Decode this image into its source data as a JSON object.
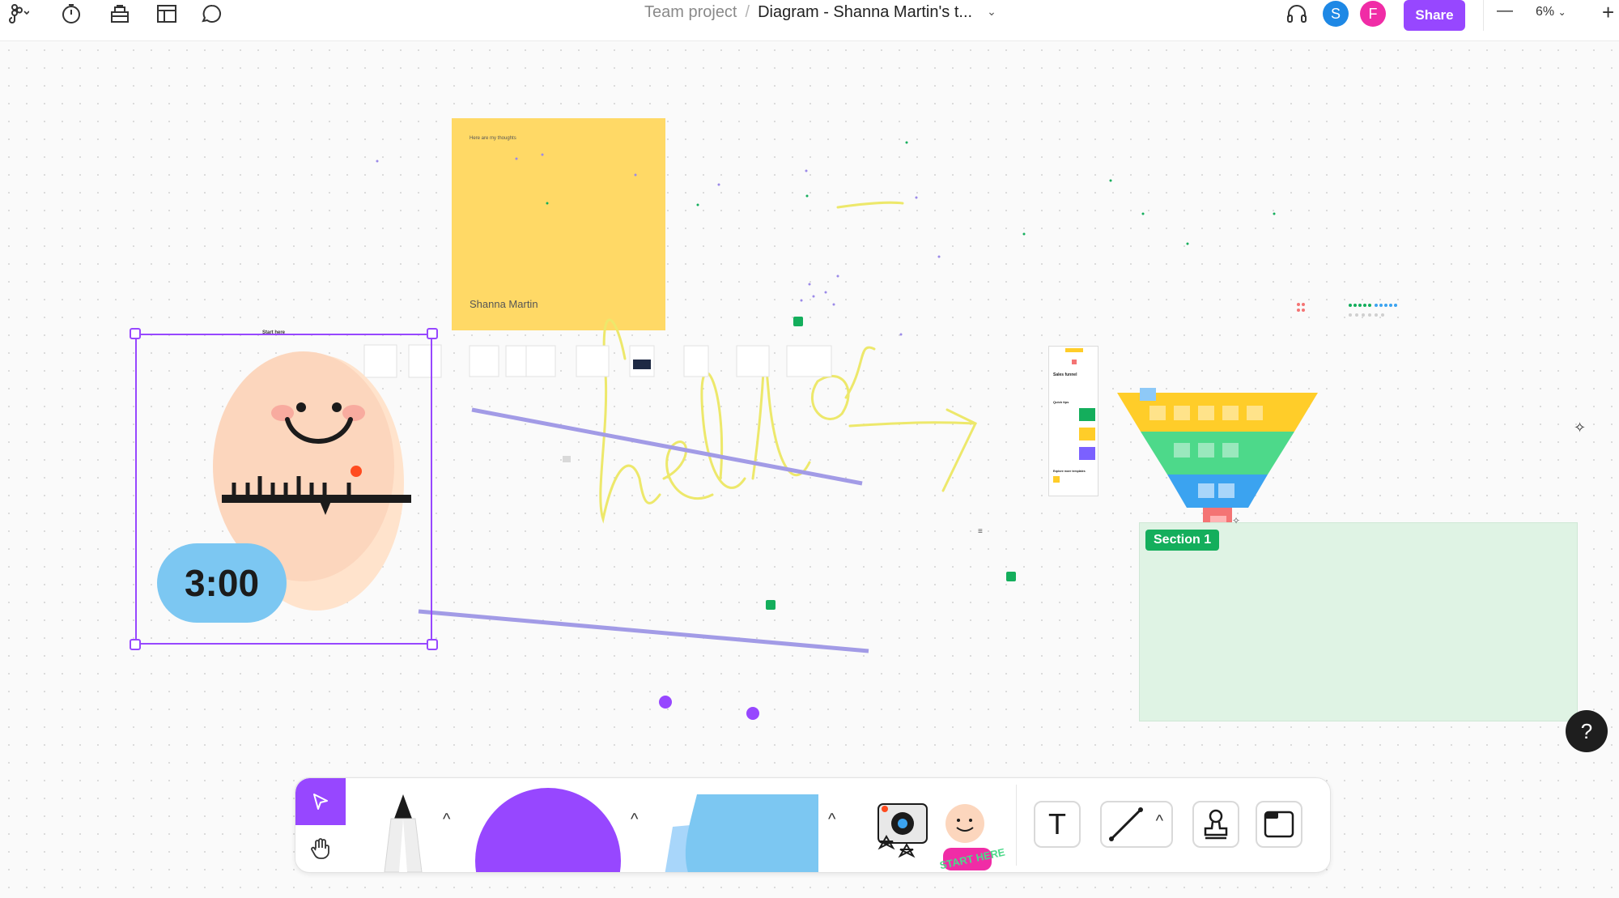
{
  "topbar": {
    "breadcrumb_project": "Team project",
    "breadcrumb_separator": "/",
    "file_title": "Diagram - Shanna Martin's t...",
    "avatars": [
      {
        "initial": "S",
        "color": "#1e88e5"
      },
      {
        "initial": "F",
        "color": "#f02ca6"
      }
    ],
    "share_label": "Share",
    "zoom_level": "6%",
    "zoom_out_symbol": "—",
    "zoom_in_symbol": "+"
  },
  "icons": {
    "main_menu": "figjam-logo-icon",
    "timer": "timer-icon",
    "library": "library-icon",
    "templates": "templates-icon",
    "comment": "comment-icon",
    "audio": "headphones-icon"
  },
  "canvas": {
    "sticky_note": {
      "heading": "Here are my thoughts",
      "author": "Shanna Martin",
      "color": "#ffd966"
    },
    "selected_frame": {
      "label": "Start here",
      "timer_text": "3:00",
      "timer_color": "#7cc7f2",
      "selection_color": "#9747ff"
    },
    "handwriting": "hello",
    "section": {
      "label": "Section 1",
      "fill": "#dff3e4",
      "label_color": "#14ae5c"
    },
    "document_card": {
      "title": "Sales funnel",
      "subtitle": "Quick tips",
      "footer": "Explore more templates"
    },
    "funnel_colors": [
      "#ffcd29",
      "#4dd98a",
      "#3ba3f0",
      "#f47474"
    ]
  },
  "toolbar": {
    "tools": [
      {
        "name": "select",
        "icon": "cursor-arrow-icon"
      },
      {
        "name": "hand",
        "icon": "hand-icon"
      },
      {
        "name": "marker",
        "icon": "marker-icon"
      },
      {
        "name": "shape",
        "icon": "shape-circle-icon"
      },
      {
        "name": "sticky",
        "icon": "sticky-note-icon"
      },
      {
        "name": "stickers",
        "icon": "stickers-icon"
      },
      {
        "name": "text",
        "icon": "text-icon"
      },
      {
        "name": "connector",
        "icon": "connector-icon"
      },
      {
        "name": "stamp",
        "icon": "stamp-icon"
      },
      {
        "name": "section",
        "icon": "section-icon"
      }
    ],
    "sticker_text": "START HERE",
    "caret": "^",
    "text_tool_glyph": "T"
  },
  "help_symbol": "?"
}
